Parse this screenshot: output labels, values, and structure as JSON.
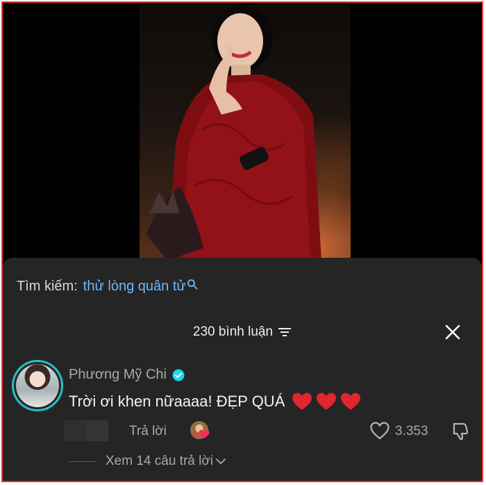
{
  "search": {
    "label": "Tìm kiếm:",
    "query": "thử lòng quân tử"
  },
  "comments_header": {
    "count_label": "230 bình luận"
  },
  "comment": {
    "username": "Phương Mỹ Chi",
    "text": "Trời ơi khen nữaaaa! ĐẸP QUÁ",
    "reply_label": "Trả lời",
    "like_count": "3.353",
    "view_replies_label": "Xem 14 câu trả lời"
  },
  "colors": {
    "accent_link": "#6fb8ff",
    "verified": "#20d5ec",
    "heart": "#e0262f",
    "sheet_bg": "#252525",
    "avatar_ring": "#27c1c8"
  },
  "icons": [
    "search-icon",
    "filter-icon",
    "close-icon",
    "verified-icon",
    "heart-icon",
    "like-icon",
    "dislike-icon",
    "chevron-down-icon"
  ]
}
